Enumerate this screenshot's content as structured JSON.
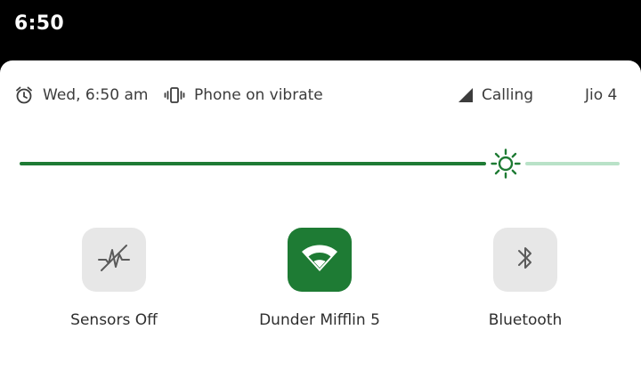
{
  "status_bar": {
    "time": "6:50"
  },
  "info_row": {
    "alarm_icon": "alarm-clock-icon",
    "alarm_text": "Wed, 6:50 am",
    "vibrate_icon": "vibrate-icon",
    "vibrate_text": "Phone on vibrate",
    "signal_icon": "cell-signal-icon",
    "calling_text": "Calling",
    "carrier_text": "Jio 4"
  },
  "brightness": {
    "level": 0.81,
    "icon": "brightness-sun-icon",
    "active_color": "#1e7b34",
    "inactive_color": "#b9e2c8"
  },
  "tiles": [
    {
      "label": "Sensors Off",
      "icon": "sensors-off-icon",
      "active": false
    },
    {
      "label": "Dunder Mifflin 5",
      "icon": "wifi-icon",
      "active": true
    },
    {
      "label": "Bluetooth",
      "icon": "bluetooth-icon",
      "active": false
    }
  ],
  "colors": {
    "accent": "#1e7b34",
    "tile_inactive": "#e7e7e7",
    "text": "#3c3c3c"
  }
}
